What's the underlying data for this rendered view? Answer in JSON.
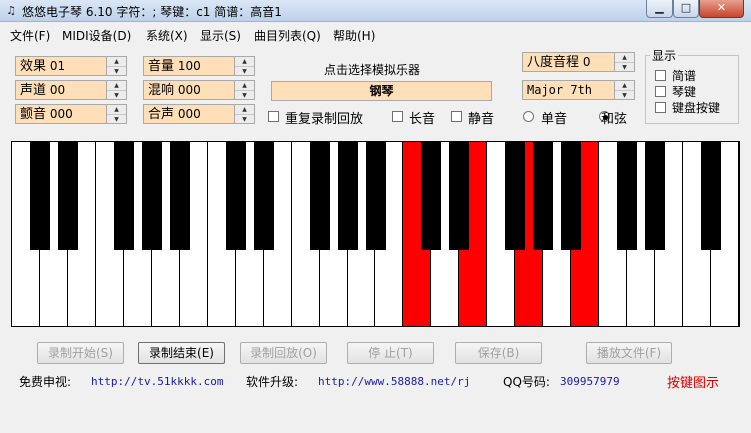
{
  "window": {
    "title": "悠悠电子琴 6.10  字符：; 琴键：c1 简谱：高音1",
    "app_icon": "music-note-icon"
  },
  "menu": [
    "文件(F)",
    "MIDI设备(D)",
    "系统(X)",
    "显示(S)",
    "曲目列表(Q)",
    "帮助(H)"
  ],
  "controls": {
    "effect": {
      "label": "效果",
      "value": "01"
    },
    "channel": {
      "label": "声道",
      "value": "00"
    },
    "vibrato": {
      "label": "颤音",
      "value": "000"
    },
    "volume": {
      "label": "音量",
      "value": "100"
    },
    "reverb": {
      "label": "混响",
      "value": "000"
    },
    "chorus": {
      "label": "合声",
      "value": "000"
    },
    "octave": {
      "label": "八度音程",
      "value": "0"
    },
    "chord_type": {
      "value": "Major 7th"
    }
  },
  "instrument": {
    "prompt": "点击选择模拟乐器",
    "selected": "钢琴"
  },
  "options": {
    "repeat_record": "重复录制回放",
    "long_note": "长音",
    "mute": "静音",
    "single_note": "单音",
    "chord": "和弦"
  },
  "display_panel": {
    "title": "显示",
    "items": [
      "简谱",
      "琴键",
      "键盘按键"
    ]
  },
  "keyboard": {
    "white_keys": 26,
    "highlighted_white": [
      14,
      16,
      18,
      20
    ],
    "highlight_color": "#ff0000",
    "black_key_color": "#000000",
    "white_key_color": "#ffffff"
  },
  "buttons": [
    {
      "label": "录制开始(S)",
      "enabled": false
    },
    {
      "label": "录制结束(E)",
      "enabled": true
    },
    {
      "label": "录制回放(O)",
      "enabled": false
    },
    {
      "label": "停 止(T)",
      "enabled": false
    },
    {
      "label": "保存(B)",
      "enabled": false
    },
    {
      "label": "播放文件(F)",
      "enabled": false
    }
  ],
  "footer": {
    "free_tv_label": "免费申视:",
    "free_tv_url": "http://tv.51kkkk.com",
    "upgrade_label": "软件升级:",
    "upgrade_url": "http://www.58888.net/rj",
    "qq_label": "QQ号码:",
    "qq_number": "309957979",
    "key_map_link": "按键图示"
  }
}
